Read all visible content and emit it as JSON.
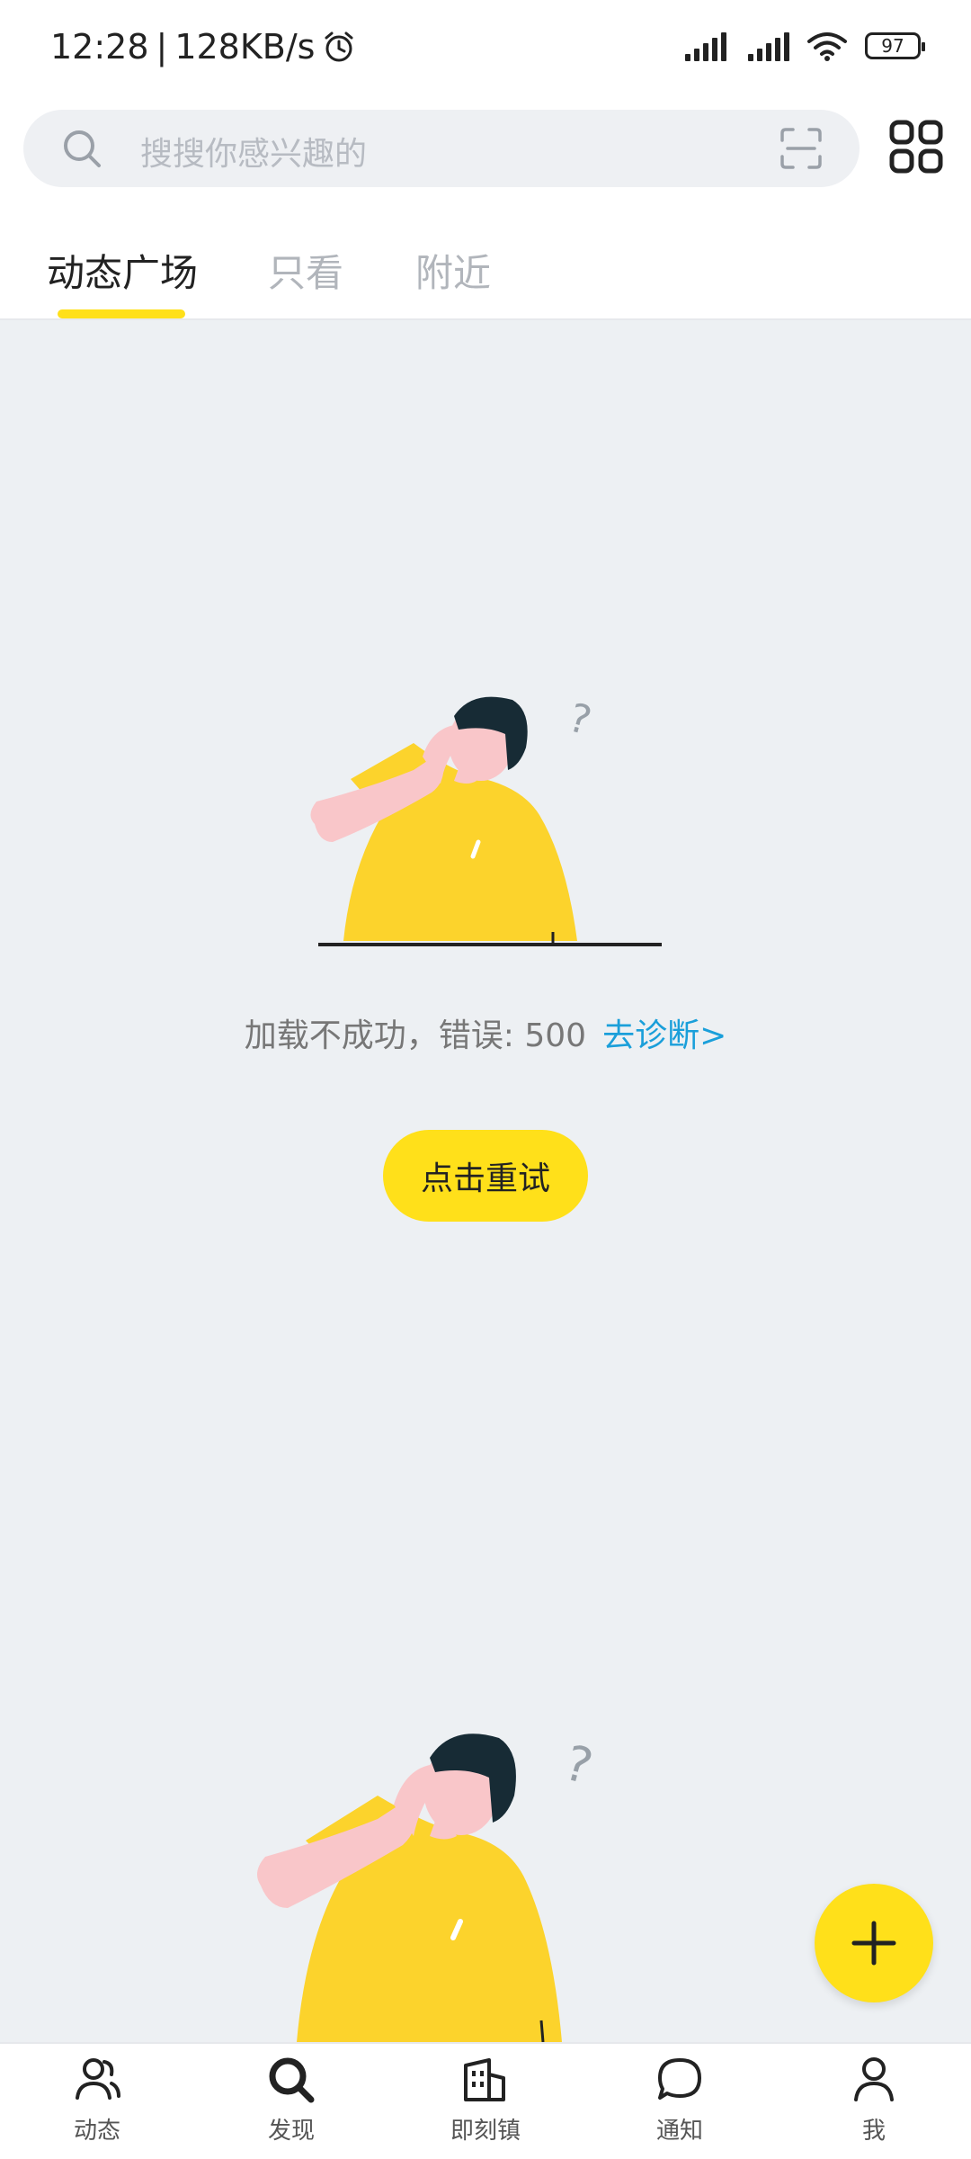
{
  "status_bar": {
    "time": "12:28",
    "speed": "128KB/s",
    "battery": "97"
  },
  "search": {
    "placeholder": "搜搜你感兴趣的"
  },
  "tabs": [
    {
      "label": "动态广场",
      "active": true
    },
    {
      "label": "只看",
      "active": false
    },
    {
      "label": "附近",
      "active": false
    }
  ],
  "error": {
    "message": "加载不成功，错误: 500",
    "diagnose_link": "去诊断>"
  },
  "retry_button": "点击重试",
  "bottom_nav": [
    {
      "label": "动态",
      "icon": "people-icon"
    },
    {
      "label": "发现",
      "icon": "search-icon"
    },
    {
      "label": "即刻镇",
      "icon": "building-icon"
    },
    {
      "label": "通知",
      "icon": "chat-bubble-icon"
    },
    {
      "label": "我",
      "icon": "person-icon"
    }
  ],
  "colors": {
    "accent": "#ffe01a",
    "link": "#1a9fda",
    "background": "#edf0f3"
  }
}
